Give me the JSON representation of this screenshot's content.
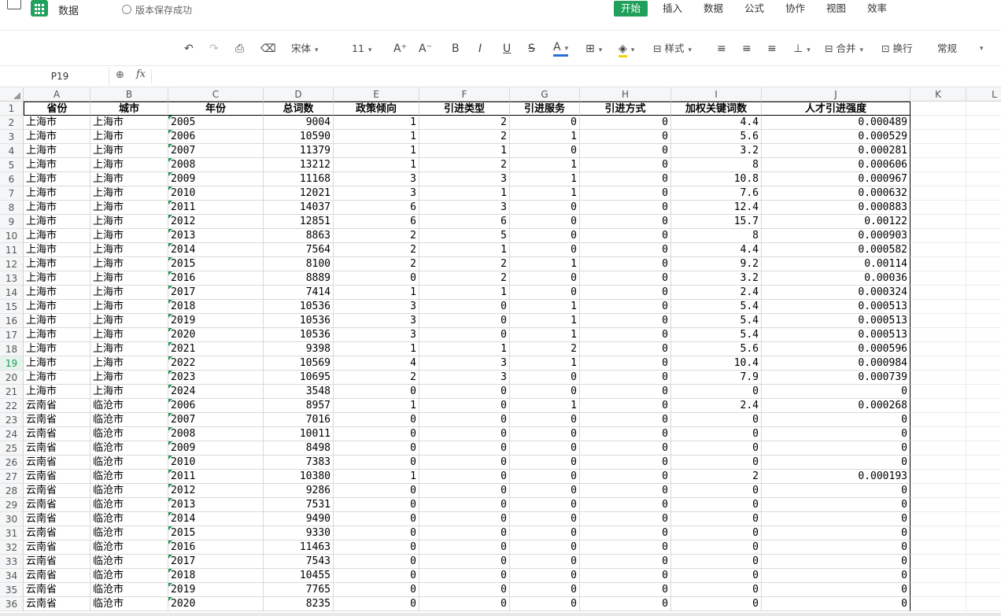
{
  "window": {
    "doc_title": "数据",
    "save_status": "版本保存成功",
    "menus": [
      "开始",
      "插入",
      "数据",
      "公式",
      "协作",
      "视图",
      "效率"
    ],
    "active_menu": "开始"
  },
  "toolbar": {
    "font_name": "宋体",
    "font_size": "11",
    "increase_font": "A⁺",
    "decrease_font": "A⁻",
    "bold": "B",
    "italic": "I",
    "underline": "U",
    "strike": "S",
    "font_color": "A",
    "style_label": "样式",
    "merge_label": "合并",
    "wrap_label": "换行",
    "number_format": "常规",
    "font_color_hex": "#2b6fd6",
    "fill_color_hex": "#f0d200"
  },
  "formula_bar": {
    "cell_ref": "P19",
    "fx": "fx",
    "formula": ""
  },
  "sheet": {
    "columns": [
      "A",
      "B",
      "C",
      "D",
      "E",
      "F",
      "G",
      "H",
      "I",
      "J",
      "K",
      "L"
    ],
    "selected_row": "19",
    "header_row": [
      "省份",
      "城市",
      "年份",
      "总词数",
      "政策倾向",
      "引进类型",
      "引进服务",
      "引进方式",
      "加权关键词数",
      "人才引进强度"
    ],
    "rows": [
      [
        "上海市",
        "上海市",
        "2005",
        "9004",
        "1",
        "2",
        "0",
        "0",
        "4.4",
        "0.000489"
      ],
      [
        "上海市",
        "上海市",
        "2006",
        "10590",
        "1",
        "2",
        "1",
        "0",
        "5.6",
        "0.000529"
      ],
      [
        "上海市",
        "上海市",
        "2007",
        "11379",
        "1",
        "1",
        "0",
        "0",
        "3.2",
        "0.000281"
      ],
      [
        "上海市",
        "上海市",
        "2008",
        "13212",
        "1",
        "2",
        "1",
        "0",
        "8",
        "0.000606"
      ],
      [
        "上海市",
        "上海市",
        "2009",
        "11168",
        "3",
        "3",
        "1",
        "0",
        "10.8",
        "0.000967"
      ],
      [
        "上海市",
        "上海市",
        "2010",
        "12021",
        "3",
        "1",
        "1",
        "0",
        "7.6",
        "0.000632"
      ],
      [
        "上海市",
        "上海市",
        "2011",
        "14037",
        "6",
        "3",
        "0",
        "0",
        "12.4",
        "0.000883"
      ],
      [
        "上海市",
        "上海市",
        "2012",
        "12851",
        "6",
        "6",
        "0",
        "0",
        "15.7",
        "0.00122"
      ],
      [
        "上海市",
        "上海市",
        "2013",
        "8863",
        "2",
        "5",
        "0",
        "0",
        "8",
        "0.000903"
      ],
      [
        "上海市",
        "上海市",
        "2014",
        "7564",
        "2",
        "1",
        "0",
        "0",
        "4.4",
        "0.000582"
      ],
      [
        "上海市",
        "上海市",
        "2015",
        "8100",
        "2",
        "2",
        "1",
        "0",
        "9.2",
        "0.00114"
      ],
      [
        "上海市",
        "上海市",
        "2016",
        "8889",
        "0",
        "2",
        "0",
        "0",
        "3.2",
        "0.00036"
      ],
      [
        "上海市",
        "上海市",
        "2017",
        "7414",
        "1",
        "1",
        "0",
        "0",
        "2.4",
        "0.000324"
      ],
      [
        "上海市",
        "上海市",
        "2018",
        "10536",
        "3",
        "0",
        "1",
        "0",
        "5.4",
        "0.000513"
      ],
      [
        "上海市",
        "上海市",
        "2019",
        "10536",
        "3",
        "0",
        "1",
        "0",
        "5.4",
        "0.000513"
      ],
      [
        "上海市",
        "上海市",
        "2020",
        "10536",
        "3",
        "0",
        "1",
        "0",
        "5.4",
        "0.000513"
      ],
      [
        "上海市",
        "上海市",
        "2021",
        "9398",
        "1",
        "1",
        "2",
        "0",
        "5.6",
        "0.000596"
      ],
      [
        "上海市",
        "上海市",
        "2022",
        "10569",
        "4",
        "3",
        "1",
        "0",
        "10.4",
        "0.000984"
      ],
      [
        "上海市",
        "上海市",
        "2023",
        "10695",
        "2",
        "3",
        "0",
        "0",
        "7.9",
        "0.000739"
      ],
      [
        "上海市",
        "上海市",
        "2024",
        "3548",
        "0",
        "0",
        "0",
        "0",
        "0",
        "0"
      ],
      [
        "云南省",
        "临沧市",
        "2006",
        "8957",
        "1",
        "0",
        "1",
        "0",
        "2.4",
        "0.000268"
      ],
      [
        "云南省",
        "临沧市",
        "2007",
        "7016",
        "0",
        "0",
        "0",
        "0",
        "0",
        "0"
      ],
      [
        "云南省",
        "临沧市",
        "2008",
        "10011",
        "0",
        "0",
        "0",
        "0",
        "0",
        "0"
      ],
      [
        "云南省",
        "临沧市",
        "2009",
        "8498",
        "0",
        "0",
        "0",
        "0",
        "0",
        "0"
      ],
      [
        "云南省",
        "临沧市",
        "2010",
        "7383",
        "0",
        "0",
        "0",
        "0",
        "0",
        "0"
      ],
      [
        "云南省",
        "临沧市",
        "2011",
        "10380",
        "1",
        "0",
        "0",
        "0",
        "2",
        "0.000193"
      ],
      [
        "云南省",
        "临沧市",
        "2012",
        "9286",
        "0",
        "0",
        "0",
        "0",
        "0",
        "0"
      ],
      [
        "云南省",
        "临沧市",
        "2013",
        "7531",
        "0",
        "0",
        "0",
        "0",
        "0",
        "0"
      ],
      [
        "云南省",
        "临沧市",
        "2014",
        "9490",
        "0",
        "0",
        "0",
        "0",
        "0",
        "0"
      ],
      [
        "云南省",
        "临沧市",
        "2015",
        "9330",
        "0",
        "0",
        "0",
        "0",
        "0",
        "0"
      ],
      [
        "云南省",
        "临沧市",
        "2016",
        "11463",
        "0",
        "0",
        "0",
        "0",
        "0",
        "0"
      ],
      [
        "云南省",
        "临沧市",
        "2017",
        "7543",
        "0",
        "0",
        "0",
        "0",
        "0",
        "0"
      ],
      [
        "云南省",
        "临沧市",
        "2018",
        "10455",
        "0",
        "0",
        "0",
        "0",
        "0",
        "0"
      ],
      [
        "云南省",
        "临沧市",
        "2019",
        "7765",
        "0",
        "0",
        "0",
        "0",
        "0",
        "0"
      ],
      [
        "云南省",
        "临沧市",
        "2020",
        "8235",
        "0",
        "0",
        "0",
        "0",
        "0",
        "0"
      ]
    ]
  }
}
